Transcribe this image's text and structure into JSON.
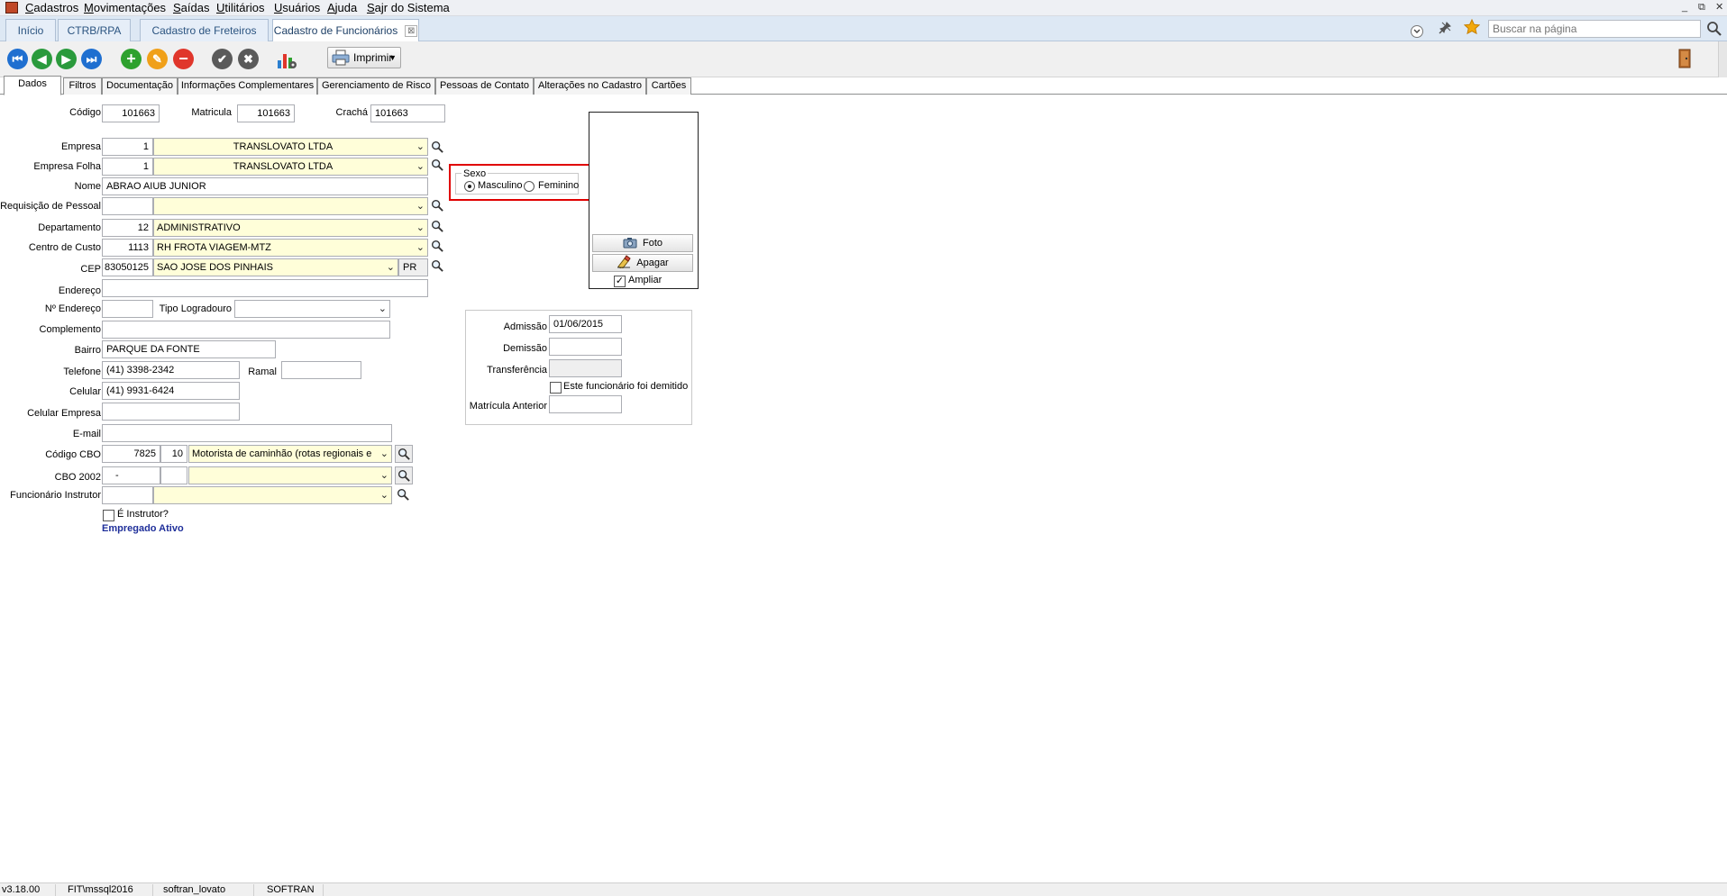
{
  "menu": {
    "items": [
      "Cadastros",
      "Movimentações",
      "Saídas",
      "Utilitários",
      "Usuários",
      "Ajuda",
      "Sajr do Sistema"
    ]
  },
  "window_controls": {
    "minimize": "_",
    "restore": "⧉",
    "close": "✕"
  },
  "doc_tabs": [
    {
      "label": "Início",
      "active": false
    },
    {
      "label": "CTRB/RPA",
      "active": false
    },
    {
      "label": "Cadastro de Freteiros",
      "active": false
    },
    {
      "label": "Cadastro de Funcionários",
      "active": true,
      "close": "⊠"
    }
  ],
  "search": {
    "placeholder": "Buscar na página"
  },
  "toolbar": {
    "print_label": "Imprimir",
    "icons": {
      "first": "first-record-icon",
      "prev": "previous-record-icon",
      "next": "next-record-icon",
      "last": "last-record-icon",
      "add": "add-icon",
      "edit": "edit-icon",
      "delete": "delete-icon",
      "confirm": "confirm-icon",
      "cancel": "cancel-icon",
      "report": "chart-icon",
      "exit": "exit-door-icon"
    },
    "colors": {
      "nav": "#1f6fd0",
      "add": "#2ea12e",
      "edit": "#f0a019",
      "delete": "#e0362b",
      "confirm": "#5a5a5a"
    }
  },
  "form_tabs": [
    {
      "label": "Dados",
      "active": true
    },
    {
      "label": "Filtros"
    },
    {
      "label": "Documentação"
    },
    {
      "label": "Informações Complementares"
    },
    {
      "label": "Gerenciamento de Risco"
    },
    {
      "label": "Pessoas de Contato"
    },
    {
      "label": "Alterações no Cadastro"
    },
    {
      "label": "Cartões"
    }
  ],
  "form": {
    "codigo": {
      "label": "Código",
      "value": "101663"
    },
    "matricula": {
      "label": "Matricula",
      "value": "101663"
    },
    "cracha": {
      "label": "Crachá",
      "value": "101663"
    },
    "empresa": {
      "label": "Empresa",
      "code": "1",
      "name": "TRANSLOVATO LTDA"
    },
    "empresa_folha": {
      "label": "Empresa Folha",
      "code": "1",
      "name": "TRANSLOVATO LTDA"
    },
    "nome": {
      "label": "Nome",
      "value": "ABRAO AIUB JUNIOR"
    },
    "requisicao": {
      "label": "Requisição de Pessoal",
      "code": "",
      "name": ""
    },
    "departamento": {
      "label": "Departamento",
      "code": "12",
      "name": "ADMINISTRATIVO"
    },
    "centro_custo": {
      "label": "Centro de Custo",
      "code": "1113",
      "name": "RH FROTA VIAGEM-MTZ"
    },
    "cep": {
      "label": "CEP",
      "code": "83050125",
      "city": "SAO JOSE DOS PINHAIS",
      "uf": "PR"
    },
    "endereco": {
      "label": "Endereço",
      "value": ""
    },
    "numero": {
      "label": "Nº Endereço",
      "value": ""
    },
    "tipo_logradouro": {
      "label": "Tipo Logradouro",
      "value": ""
    },
    "complemento": {
      "label": "Complemento",
      "value": ""
    },
    "bairro": {
      "label": "Bairro",
      "value": "PARQUE DA FONTE"
    },
    "telefone": {
      "label": "Telefone",
      "value": "(41) 3398-2342"
    },
    "ramal": {
      "label": "Ramal",
      "value": ""
    },
    "celular": {
      "label": "Celular",
      "value": "(41) 9931-6424"
    },
    "celular_empresa": {
      "label": "Celular Empresa",
      "value": ""
    },
    "email": {
      "label": "E-mail",
      "value": ""
    },
    "cbo": {
      "label": "Código CBO",
      "code": "7825",
      "sub": "10",
      "name": "Motorista de caminhão (rotas regionais e"
    },
    "cbo2002": {
      "label": "CBO 2002",
      "code": "-",
      "sub": "",
      "name": ""
    },
    "instrutor": {
      "label": "Funcionário Instrutor",
      "code": "",
      "name": ""
    },
    "e_instrutor": {
      "label": "É Instrutor?",
      "checked": false
    },
    "status": {
      "text": "Empregado Ativo",
      "color": "#1f2f9a"
    }
  },
  "sexo": {
    "label": "Sexo",
    "options": [
      "Masculino",
      "Feminino"
    ],
    "selected": "Masculino",
    "highlight_color": "#e00000"
  },
  "photo": {
    "foto_label": "Foto",
    "apagar_label": "Apagar",
    "ampliar_label": "Ampliar",
    "ampliar_checked": true
  },
  "dates": {
    "admissao": {
      "label": "Admissão",
      "value": "01/06/2015"
    },
    "demissao": {
      "label": "Demissão",
      "value": ""
    },
    "transferencia": {
      "label": "Transferência",
      "value": ""
    },
    "demitido": {
      "label": "Este funcionário foi demitido",
      "checked": false
    },
    "matricula_anterior": {
      "label": "Matrícula Anterior",
      "value": ""
    }
  },
  "statusbar": [
    "v3.18.00",
    "FIT\\mssql2016",
    "softran_lovato",
    "SOFTRAN"
  ]
}
